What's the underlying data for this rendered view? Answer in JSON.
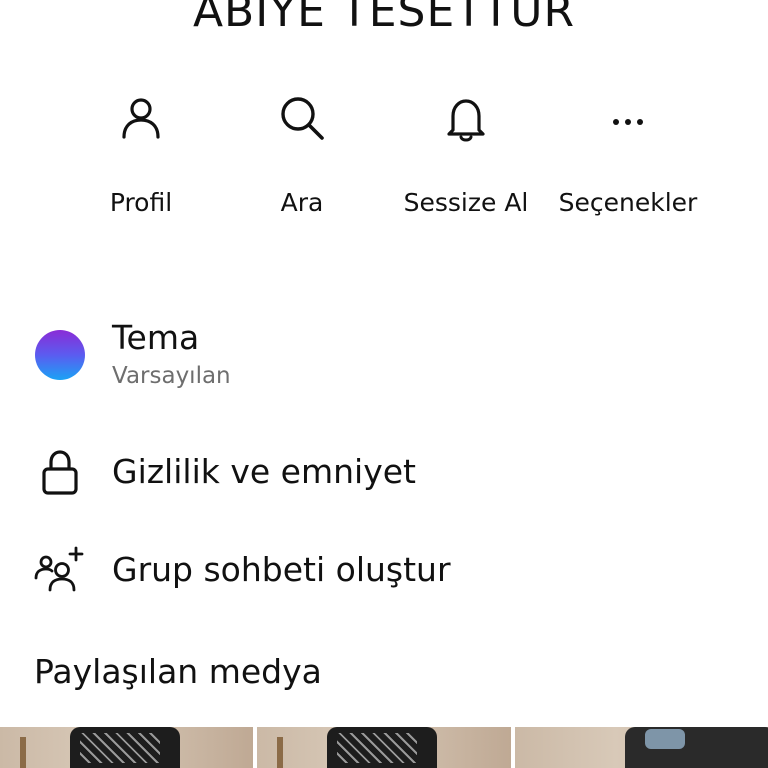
{
  "header": {
    "title": "ABIYE TESETTUR"
  },
  "actions": [
    {
      "label": "Profil",
      "icon": "person-icon"
    },
    {
      "label": "Ara",
      "icon": "search-icon"
    },
    {
      "label": "Sessize Al",
      "icon": "bell-icon"
    },
    {
      "label": "Seçenekler",
      "icon": "more-icon"
    }
  ],
  "settings": {
    "theme": {
      "label": "Tema",
      "value": "Varsayılan",
      "colors": [
        "#8a2cd6",
        "#5b5cf0",
        "#1aa3f5"
      ]
    },
    "privacy": {
      "label": "Gizlilik ve emniyet",
      "icon": "lock-icon"
    },
    "group": {
      "label": "Grup sohbeti oluştur",
      "icon": "add-group-icon"
    }
  },
  "media": {
    "title": "Paylaşılan medya",
    "count_visible": 3
  }
}
